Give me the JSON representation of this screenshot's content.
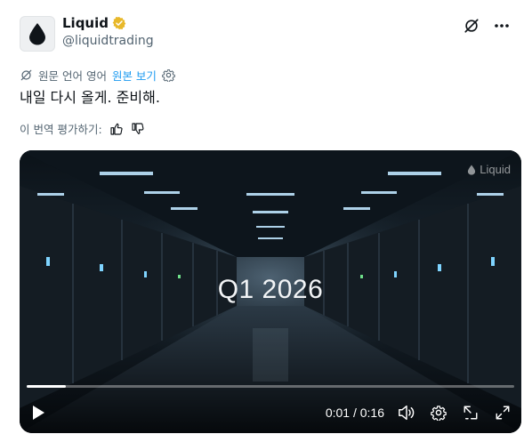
{
  "author": {
    "display_name": "Liquid",
    "handle": "@liquidtrading",
    "verified_color": "#e8b82a"
  },
  "header_icons": [
    "grok-icon",
    "more-icon"
  ],
  "translation": {
    "source_note": "원문 언어 영어",
    "show_original": "원본 보기"
  },
  "tweet": {
    "text": "내일 다시 올게. 준비해."
  },
  "rate": {
    "label": "이 번역 평가하기:"
  },
  "video": {
    "watermark": "Liquid",
    "overlay_text": "Q1 2026",
    "time": "0:01 / 0:16",
    "progress": 0.08
  },
  "colors": {
    "link": "#1d9bf0",
    "secondary_text": "#536471"
  }
}
